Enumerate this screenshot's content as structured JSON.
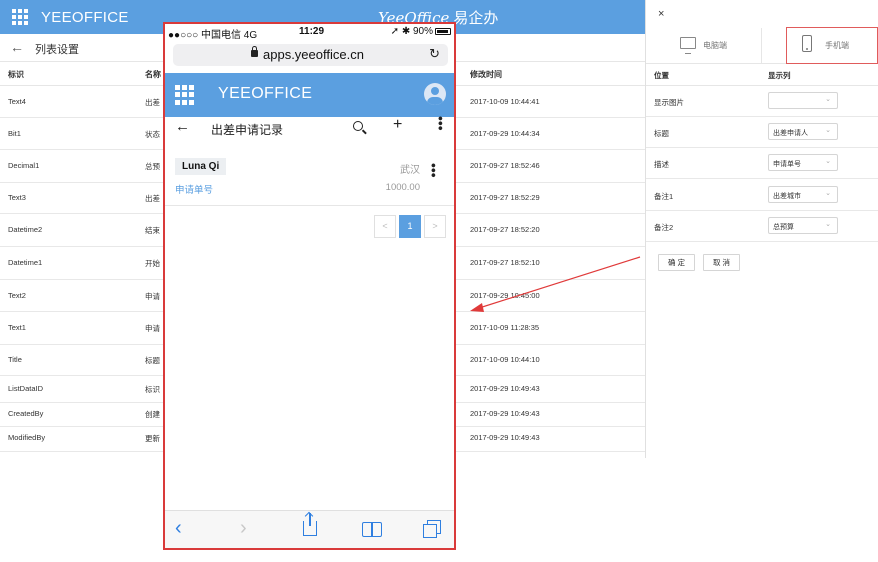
{
  "app": {
    "brand": "YEEOFFICE",
    "logo_text": "YeeOffice",
    "logo_cn": "易企办"
  },
  "subbar": {
    "back_icon": "←",
    "title": "列表设置"
  },
  "table": {
    "headers": [
      "标识",
      "名称",
      "修改时间"
    ],
    "rows": [
      {
        "id": "Text4",
        "name": "出差",
        "time": "2017-10-09 10:44:41"
      },
      {
        "id": "Bit1",
        "name": "状态",
        "time": "2017-09-29 10:44:34"
      },
      {
        "id": "Decimal1",
        "name": "总预",
        "time": "2017-09-27 18:52:46"
      },
      {
        "id": "Text3",
        "name": "出差",
        "time": "2017-09-27 18:52:29"
      },
      {
        "id": "Datetime2",
        "name": "结束",
        "time": "2017-09-27 18:52:20"
      },
      {
        "id": "Datetime1",
        "name": "开始",
        "time": "2017-09-27 18:52:10"
      },
      {
        "id": "Text2",
        "name": "申请",
        "time": "2017-09-29 10:45:00"
      },
      {
        "id": "Text1",
        "name": "申请",
        "time": "2017-10-09 11:28:35"
      },
      {
        "id": "Title",
        "name": "标题",
        "time": "2017-10-09 10:44:10"
      },
      {
        "id": "ListDataID",
        "name": "标识",
        "time": "2017-09-29 10:49:43"
      },
      {
        "id": "CreatedBy",
        "name": "创建",
        "time": "2017-09-29 10:49:43"
      },
      {
        "id": "ModifiedBy",
        "name": "更新",
        "time": "2017-09-29 10:49:43"
      }
    ]
  },
  "panel": {
    "close": "×",
    "tab_pc": "电脑端",
    "tab_mobile": "手机端",
    "col_position": "位置",
    "col_display": "显示列",
    "rows": [
      {
        "position": "显示图片",
        "value": ""
      },
      {
        "position": "标题",
        "value": "出差申请人"
      },
      {
        "position": "描述",
        "value": "申请单号"
      },
      {
        "position": "备注1",
        "value": "出差城市"
      },
      {
        "position": "备注2",
        "value": "总预算"
      }
    ],
    "ok": "确 定",
    "cancel": "取 消"
  },
  "phone": {
    "carrier": "●●○○○ 中国电信  4G",
    "time": "11:29",
    "battery": "90%",
    "url": "apps.yeeoffice.cn",
    "app_brand": "YEEOFFICE",
    "page_title": "出差申请记录",
    "card": {
      "name": "Luna Qi",
      "city": "武汉",
      "apply_label": "申请单号",
      "amount": "1000.00"
    },
    "pager": {
      "prev": "<",
      "current": "1",
      "next": ">"
    }
  },
  "colors": {
    "brand_blue": "#5b9fe0",
    "highlight_red": "#d93a3a",
    "ios_blue": "#2f7fe0"
  }
}
